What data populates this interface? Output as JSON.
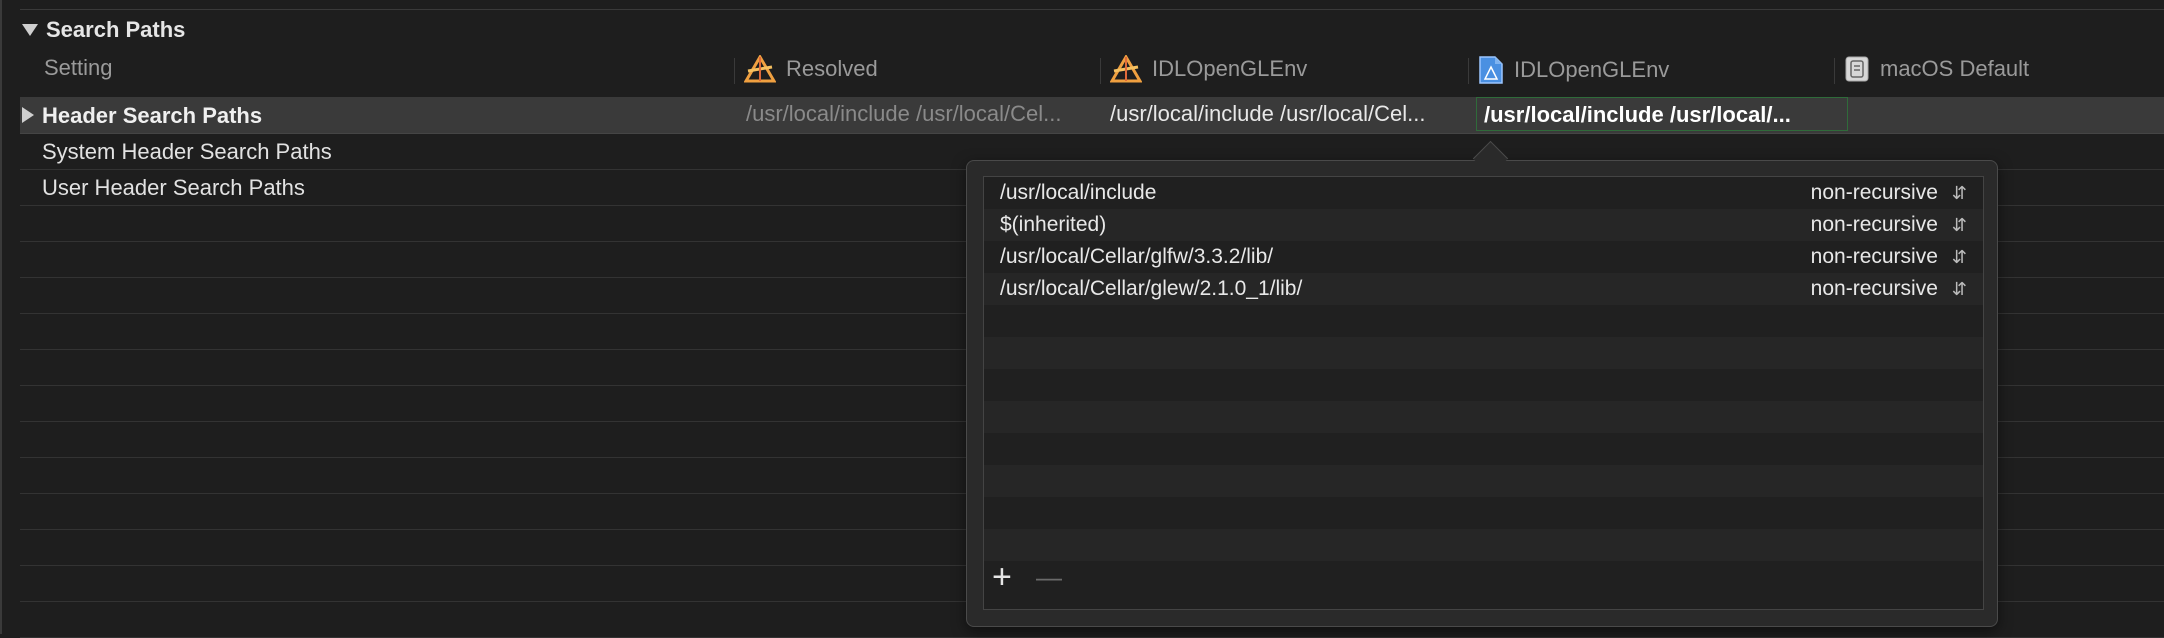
{
  "section": {
    "title": "Search Paths"
  },
  "columns": {
    "setting": "Setting",
    "resolved": "Resolved",
    "target": "IDLOpenGLEnv",
    "project": "IDLOpenGLEnv",
    "default": "macOS Default"
  },
  "rows": [
    {
      "label": "Header Search Paths",
      "resolved": "/usr/local/include  /usr/local/Cel...",
      "target": "/usr/local/include  /usr/local/Cel...",
      "project": "/usr/local/include  /usr/local/..."
    },
    {
      "label": "System Header Search Paths"
    },
    {
      "label": "User Header Search Paths"
    }
  ],
  "popover": {
    "entries": [
      {
        "path": "/usr/local/include",
        "mode": "non-recursive"
      },
      {
        "path": "$(inherited)",
        "mode": "non-recursive"
      },
      {
        "path": "/usr/local/Cellar/glfw/3.3.2/lib/",
        "mode": "non-recursive"
      },
      {
        "path": "/usr/local/Cellar/glew/2.1.0_1/lib/",
        "mode": "non-recursive"
      }
    ],
    "add_label": "+",
    "remove_label": "—"
  }
}
